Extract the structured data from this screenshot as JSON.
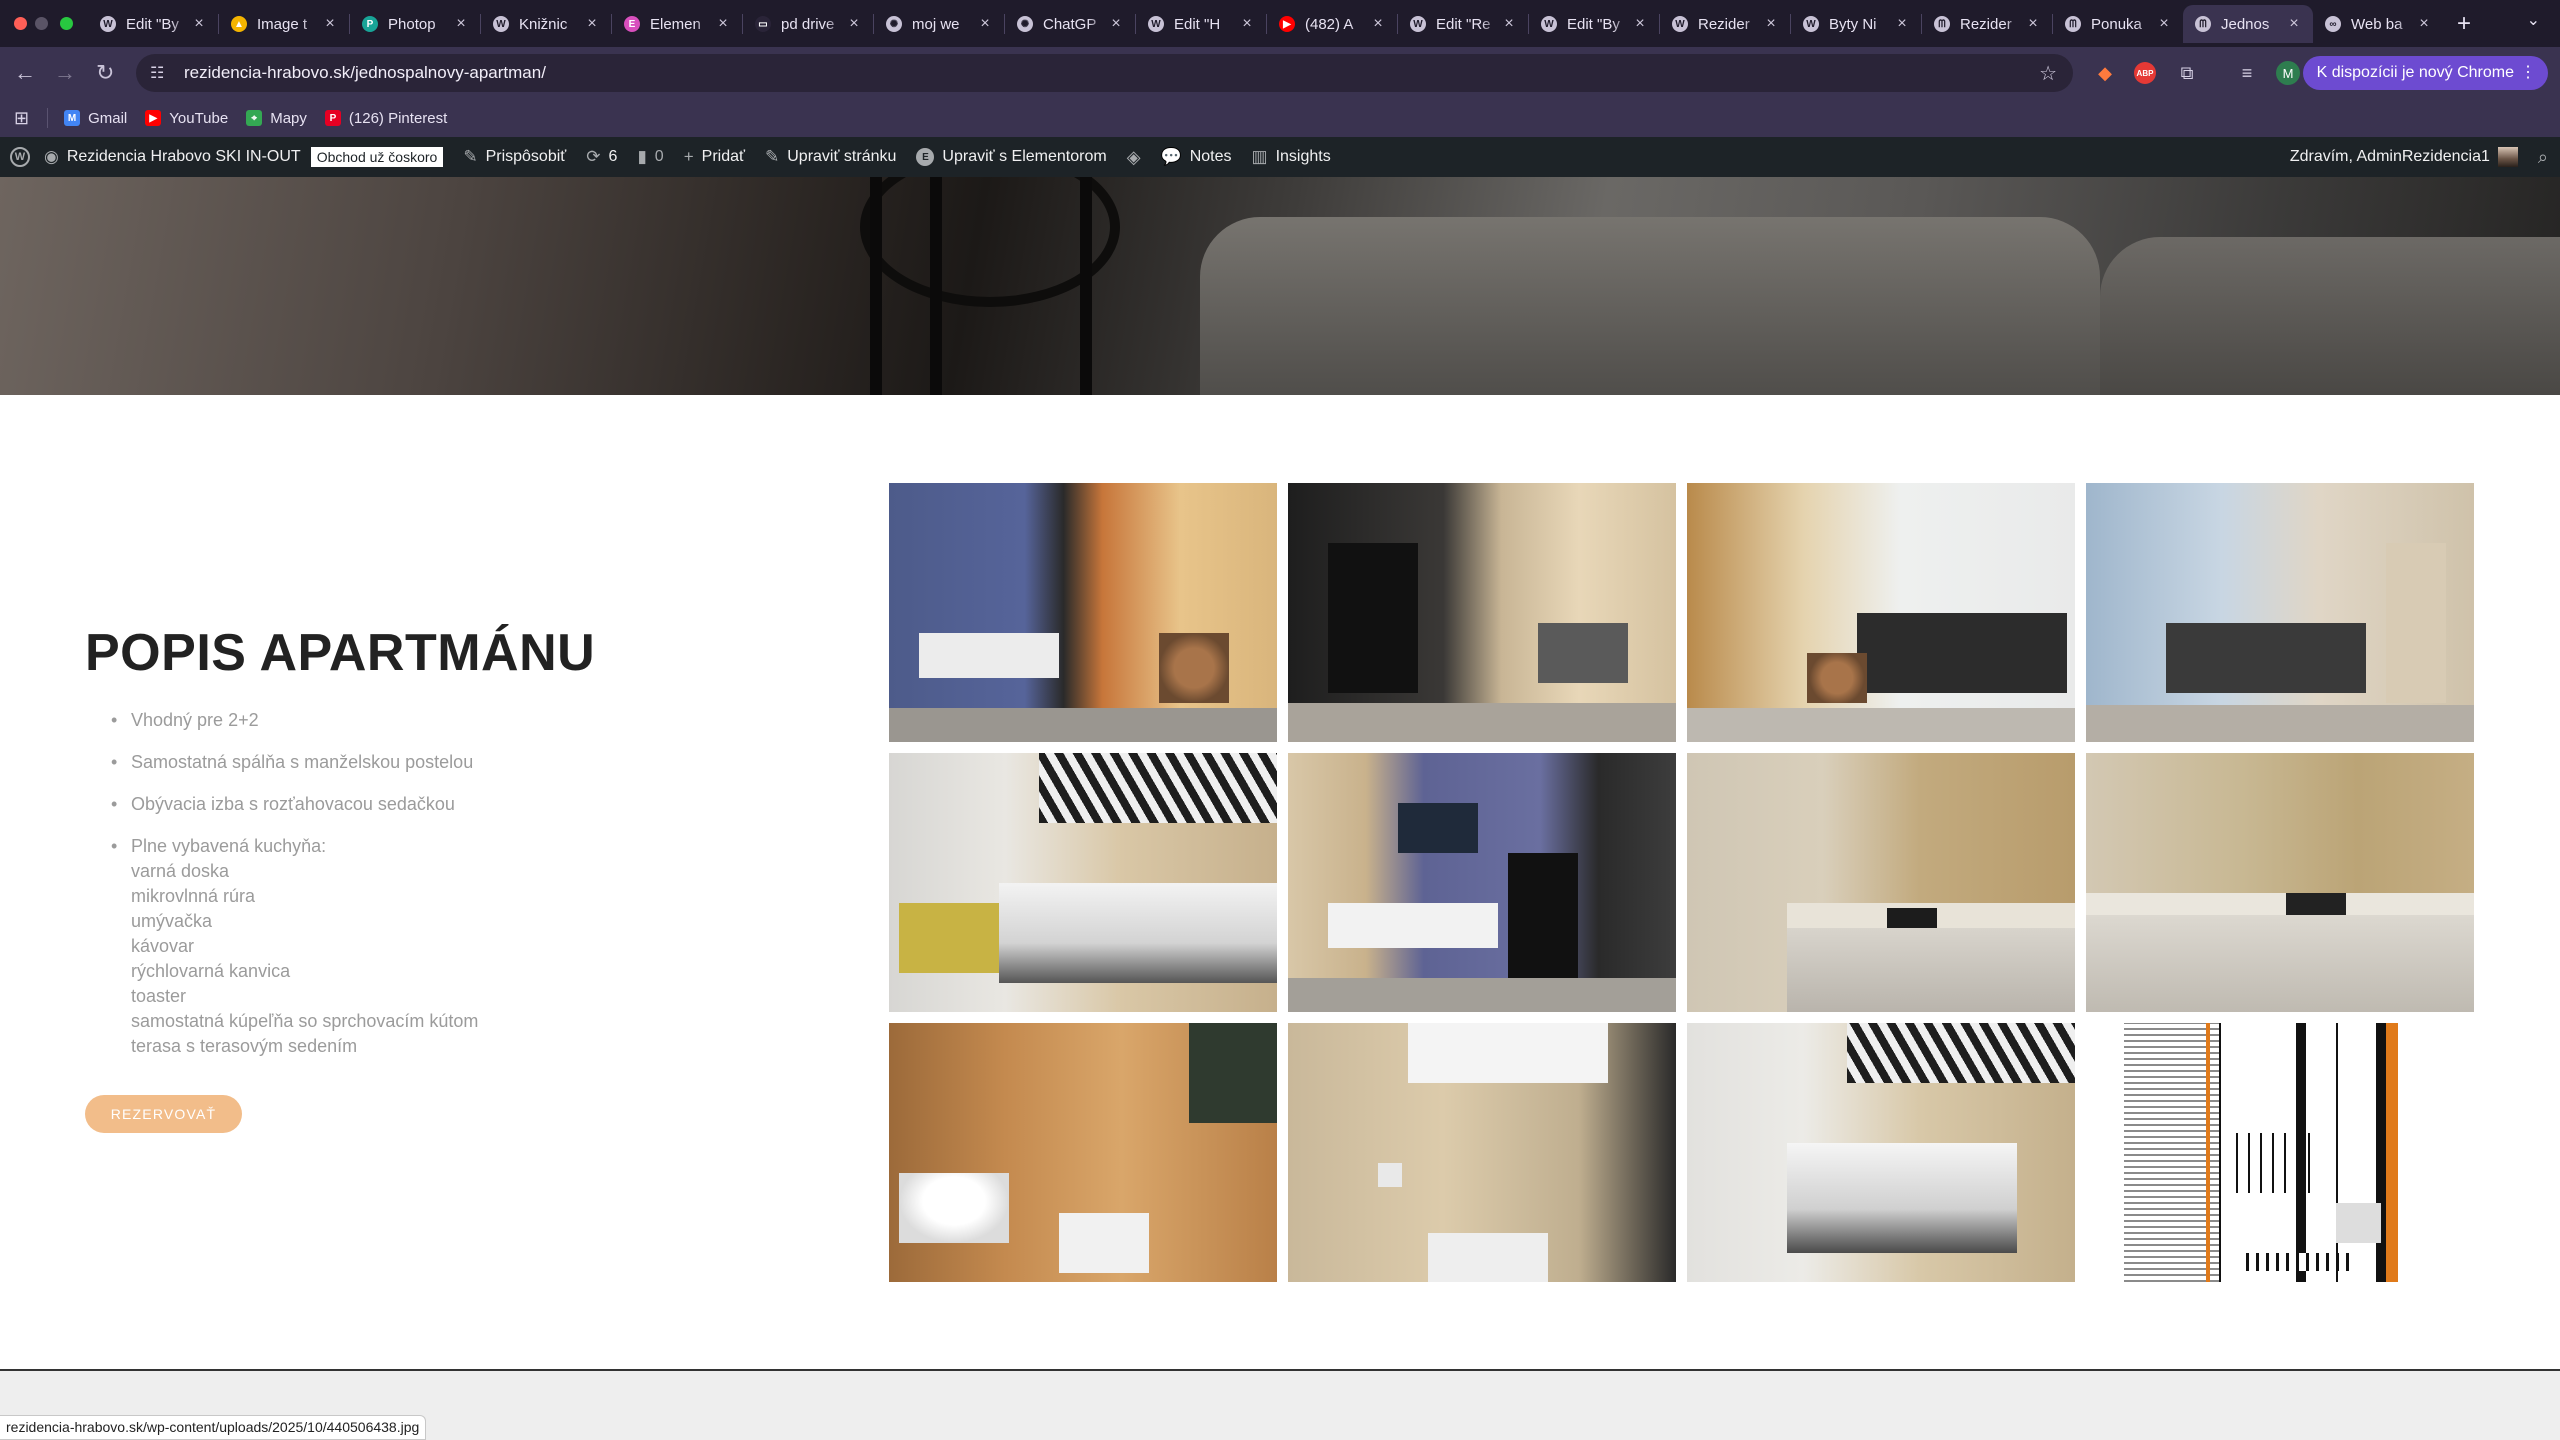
{
  "browser": {
    "tabs": [
      {
        "title": "Edit \"By",
        "icon": "wordpress-icon",
        "color": "#c8c2d6"
      },
      {
        "title": "Image t",
        "icon": "drive-icon",
        "color": "#f4b400"
      },
      {
        "title": "Photop",
        "icon": "photopea-icon",
        "color": "#18a497"
      },
      {
        "title": "Knižnic",
        "icon": "wordpress-icon",
        "color": "#c8c2d6"
      },
      {
        "title": "Elemen",
        "icon": "elementor-icon",
        "color": "#d84fbd"
      },
      {
        "title": "pd drive",
        "icon": "doc-icon",
        "color": "#2a2438"
      },
      {
        "title": "moj we",
        "icon": "chatgpt-icon",
        "color": "#c8c2d6"
      },
      {
        "title": "ChatGP",
        "icon": "chatgpt-icon",
        "color": "#c8c2d6"
      },
      {
        "title": "Edit \"H",
        "icon": "wordpress-icon",
        "color": "#c8c2d6"
      },
      {
        "title": "(482) A",
        "icon": "youtube-icon",
        "color": "#ff0000"
      },
      {
        "title": "Edit \"Re",
        "icon": "wordpress-icon",
        "color": "#c8c2d6"
      },
      {
        "title": "Edit \"By",
        "icon": "wordpress-icon",
        "color": "#c8c2d6"
      },
      {
        "title": "Rezider",
        "icon": "wordpress-icon",
        "color": "#c8c2d6"
      },
      {
        "title": "Byty Ni",
        "icon": "wordpress-icon",
        "color": "#c8c2d6"
      },
      {
        "title": "Rezider",
        "icon": "site-icon",
        "color": "#c8c2d6"
      },
      {
        "title": "Ponuka",
        "icon": "site-icon",
        "color": "#c8c2d6"
      },
      {
        "title": "Jednos",
        "icon": "site-icon",
        "color": "#c8c2d6",
        "active": true
      },
      {
        "title": "Web ba",
        "icon": "link-icon",
        "color": "#c8c2d6"
      }
    ],
    "url": "rezidencia-hrabovo.sk/jednospalnovy-apartman/",
    "promo_label": "K dispozícii je nový Chrome",
    "profile_initial": "M",
    "abp_label": "ABP",
    "bookmarks": [
      {
        "label": "Gmail",
        "icon": "gmail-icon",
        "color": "#4285f4"
      },
      {
        "label": "YouTube",
        "icon": "youtube-icon",
        "color": "#ff0000"
      },
      {
        "label": "Mapy",
        "icon": "maps-icon",
        "color": "#34a853"
      },
      {
        "label": "(126) Pinterest",
        "icon": "pinterest-icon",
        "color": "#e60023"
      }
    ]
  },
  "adminbar": {
    "site_name": "Rezidencia Hrabovo SKI IN-OUT",
    "badge": "Obchod už čoskoro",
    "customize": "Prispôsobiť",
    "updates": "6",
    "comments": "0",
    "add_new": "Pridať",
    "edit_page": "Upraviť stránku",
    "edit_elementor": "Upraviť s Elementorom",
    "notes": "Notes",
    "insights": "Insights",
    "greeting": "Zdravím, AdminRezidencia1"
  },
  "content": {
    "title": "POPIS APARTMÁNU",
    "features": [
      "Vhodný pre 2+2",
      "Samostatná spálňa s manželskou postelou",
      "Obývacia izba s rozťahovacou sedačkou"
    ],
    "kitchen_heading": "Plne vybavená kuchyňa:",
    "kitchen_items": [
      "varná doska",
      "mikrovlnná rúra",
      "umývačka",
      "kávovar",
      "rýchlovarná kanvica",
      "toaster",
      "samostatná kúpeľňa so sprchovacím kútom",
      "terasa s terasovým sedením"
    ],
    "reserve_label": "REZERVOVAŤ"
  },
  "gallery": [
    {
      "name": "photo-living-room-tv",
      "theme": "living"
    },
    {
      "name": "photo-fireplace-dining",
      "theme": "dining"
    },
    {
      "name": "photo-sofa-window",
      "theme": "sofa"
    },
    {
      "name": "photo-living-room-curtains",
      "theme": "sofa2"
    },
    {
      "name": "photo-bedroom-mural",
      "theme": "bed"
    },
    {
      "name": "photo-tv-fireplace",
      "theme": "tv"
    },
    {
      "name": "photo-kitchen-1",
      "theme": "kitchen"
    },
    {
      "name": "photo-kitchen-2",
      "theme": "kitchen2"
    },
    {
      "name": "photo-bathroom-sink",
      "theme": "bath"
    },
    {
      "name": "photo-bathroom-mirror",
      "theme": "bath2"
    },
    {
      "name": "photo-bedroom-2",
      "theme": "bed2"
    },
    {
      "name": "photo-floor-plan",
      "theme": "plan"
    }
  ],
  "status_url": "rezidencia-hrabovo.sk/wp-content/uploads/2025/10/440506438.jpg"
}
